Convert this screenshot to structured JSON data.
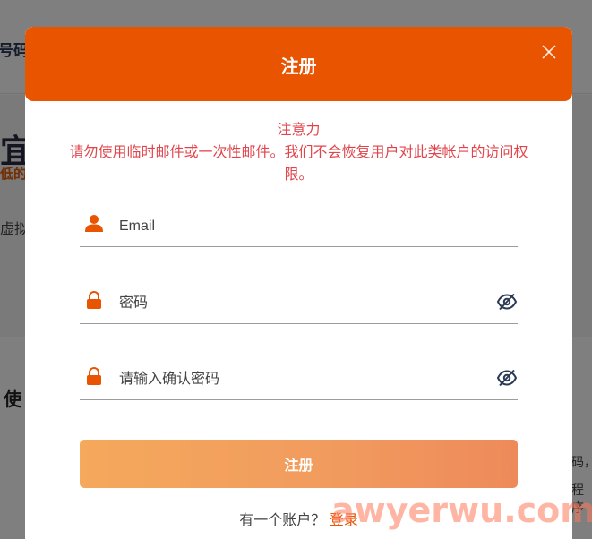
{
  "background": {
    "tab_text": "号码",
    "hero_title": "宜",
    "hero_sub": "低的",
    "hero_text": "虚拟在",
    "section_title": "使",
    "right_text_1": "码，",
    "right_text_2": "程序"
  },
  "modal": {
    "title": "注册",
    "close_icon": "close-icon",
    "notice_title": "注意力",
    "notice_body": "请勿使用临时邮件或一次性邮件。我们不会恢复用户对此类帐户的访问权限。",
    "fields": [
      {
        "icon": "user-icon",
        "placeholder": "Email",
        "value": ""
      },
      {
        "icon": "lock-icon",
        "placeholder": "密码",
        "value": "",
        "toggle_icon": "eye-hidden-icon"
      },
      {
        "icon": "lock-icon",
        "placeholder": "请输入确认密码",
        "value": "",
        "toggle_icon": "eye-hidden-icon"
      }
    ],
    "submit_label": "注册",
    "login_prompt": "有一个账户？",
    "login_link": "登录"
  },
  "watermark": "awyerwu.com",
  "colors": {
    "accent": "#e85400",
    "notice": "#e0454b",
    "button_start": "#f5a95c",
    "button_end": "#ee8a5a"
  }
}
